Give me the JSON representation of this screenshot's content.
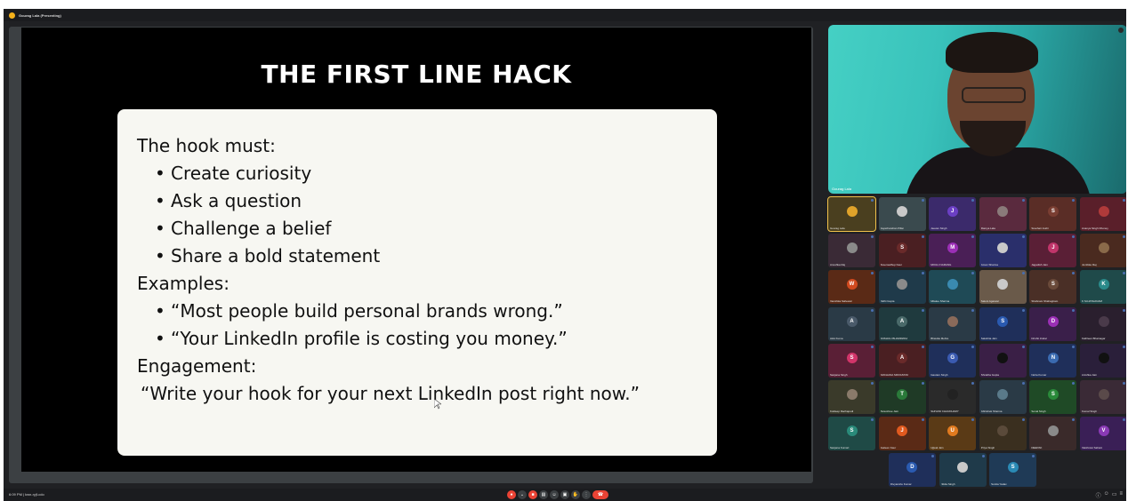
{
  "window": {
    "title": "Gourag Lala (Presenting)"
  },
  "slide": {
    "title": "THE FIRST LINE HACK",
    "intro": "The hook must:",
    "hook_points": [
      "Create curiosity",
      "Ask a question",
      "Challenge a belief",
      "Share a bold statement"
    ],
    "examples_label": "Examples:",
    "examples": [
      "“Most people build personal brands wrong.”",
      "“Your LinkedIn profile is costing you money.”"
    ],
    "engagement_label": "Engagement:",
    "engagement_quote": "“Write your hook for your next LinkedIn post right now.”"
  },
  "speaker": {
    "name": "Gourag Lala"
  },
  "colors": {
    "meet_bg": "#202124",
    "slide_bg": "#000000",
    "card_bg": "#f7f7f2",
    "leave_red": "#ea4335",
    "active_border": "#f0c14b"
  },
  "participants": [
    {
      "initial": "",
      "color": "#e0a32a",
      "name": "Gourag Lala",
      "bg": "#4a3f1f"
    },
    {
      "initial": "",
      "color": "#c9c9c9",
      "name": "Jayachandran Pillai",
      "bg": "#3a4a4e"
    },
    {
      "initial": "J",
      "color": "#6b3fc4",
      "name": "Jeevan Singh",
      "bg": "#3b2a6b"
    },
    {
      "initial": "",
      "color": "#8a7a7a",
      "name": "Ramya Lala",
      "bg": "#5a2a3e"
    },
    {
      "initial": "S",
      "color": "#7a3e32",
      "name": "Sreehari Joshi",
      "bg": "#5a2d26"
    },
    {
      "initial": "",
      "color": "#b03a3a",
      "name": "Ananya Singh Dhoney",
      "bg": "#5a1f2a"
    },
    {
      "initial": "",
      "color": "#8a8a8a",
      "name": "Anushka Raj",
      "bg": "#3a2a36"
    },
    {
      "initial": "S",
      "color": "#6a2a2a",
      "name": "Sreemadhup Kaur",
      "bg": "#4a1f22"
    },
    {
      "initial": "M",
      "color": "#9b2fb5",
      "name": "MOULI NARANG",
      "bg": "#4a1f56"
    },
    {
      "initial": "",
      "color": "#c9c9c9",
      "name": "Aman Sharma",
      "bg": "#2a2f6b"
    },
    {
      "initial": "J",
      "color": "#c0356a",
      "name": "Jagadish Jain",
      "bg": "#5a1f36"
    },
    {
      "initial": "",
      "color": "#8a6a4a",
      "name": "Jumbike Raj",
      "bg": "#4a2a1f"
    },
    {
      "initial": "W",
      "color": "#d14a1f",
      "name": "Vanshika Sahewal",
      "bg": "#5a2a16"
    },
    {
      "initial": "",
      "color": "#8a8a8a",
      "name": "Nidhi Gupta",
      "bg": "#1f3a4a"
    },
    {
      "initial": "",
      "color": "#3a8ab0",
      "name": "Mitalee Sharma",
      "bg": "#1f4a56"
    },
    {
      "initial": "",
      "color": "#c9c9c9",
      "name": "Saloni Agarwal",
      "bg": "#6a5a4a"
    },
    {
      "initial": "S",
      "color": "#6a4a3a",
      "name": "Shabnam Shahagiram",
      "bg": "#4a2f26"
    },
    {
      "initial": "K",
      "color": "#2a8a8a",
      "name": "K SUJATHANAM",
      "bg": "#1f4a4a"
    },
    {
      "initial": "A",
      "color": "#4a5a6a",
      "name": "Alok Kuma",
      "bg": "#2a3a46"
    },
    {
      "initial": "A",
      "color": "#4a6a6a",
      "name": "ANSHULI BHARDWAJ",
      "bg": "#1f3a3e"
    },
    {
      "initial": "",
      "color": "#8a6a5a",
      "name": "Bhavika Mehra",
      "bg": "#2a3a46"
    },
    {
      "initial": "S",
      "color": "#2a5ab0",
      "name": "Sakshita Jain",
      "bg": "#1f2f5a"
    },
    {
      "initial": "D",
      "color": "#9b2fb5",
      "name": "Drishti Jindal",
      "bg": "#3a1f4a"
    },
    {
      "initial": "",
      "color": "#4a3a4a",
      "name": "Kathleen Bhatnagar",
      "bg": "#2a1f2e"
    },
    {
      "initial": "S",
      "color": "#d1356a",
      "name": "Sanjana Singh",
      "bg": "#5a1f36"
    },
    {
      "initial": "A",
      "color": "#6a2a2a",
      "name": "ARCHANA SRIVASTAV",
      "bg": "#4a1f22"
    },
    {
      "initial": "G",
      "color": "#3a5ab0",
      "name": "Gautam Singh",
      "bg": "#1f2f5a"
    },
    {
      "initial": "",
      "color": "#111111",
      "name": "Shrakha Gupta",
      "bg": "#3a1f46"
    },
    {
      "initial": "N",
      "color": "#3a6ab0",
      "name": "Neha Kumar",
      "bg": "#1f2f5a"
    },
    {
      "initial": "",
      "color": "#111111",
      "name": "Anishka Jain",
      "bg": "#2a1f3a"
    },
    {
      "initial": "",
      "color": "#8a7a6a",
      "name": "Kuldeep Rachapudi",
      "bg": "#3a3a2a"
    },
    {
      "initial": "T",
      "color": "#2a7a3a",
      "name": "Tanushree Jain",
      "bg": "#1f3a26"
    },
    {
      "initial": "",
      "color": "#222222",
      "name": "SHIVANI CHAUDHARY",
      "bg": "#2a2a2a"
    },
    {
      "initial": "",
      "color": "#5a7a8a",
      "name": "Abhishek Sharma",
      "bg": "#2a3a46"
    },
    {
      "initial": "S",
      "color": "#2a8a3a",
      "name": "Sonal Singh",
      "bg": "#1f4a26"
    },
    {
      "initial": "",
      "color": "#5a4a4a",
      "name": "Komal Singh",
      "bg": "#3a2a36"
    },
    {
      "initial": "S",
      "color": "#2a8a7a",
      "name": "Sanjana Kumari",
      "bg": "#1f4a46"
    },
    {
      "initial": "J",
      "color": "#e05a1f",
      "name": "Jasleen Kaur",
      "bg": "#5a2a16"
    },
    {
      "initial": "U",
      "color": "#e07a1f",
      "name": "Ujjwal Jain",
      "bg": "#5a3a16"
    },
    {
      "initial": "",
      "color": "#5a4a3a",
      "name": "Priya Singh",
      "bg": "#3a2f1f"
    },
    {
      "initial": "",
      "color": "#8a8a8a",
      "name": "DEEPAK",
      "bg": "#3a2a2a"
    },
    {
      "initial": "V",
      "color": "#8a3ab5",
      "name": "Vaishnavi Sahani",
      "bg": "#3a1f56"
    },
    {
      "initial": "D",
      "color": "#2a5ab0",
      "name": "Divyanshu Kumar",
      "bg": "#1f2f5a"
    },
    {
      "initial": "",
      "color": "#c9c9c9",
      "name": "Nikita Singh",
      "bg": "#1f3a4a"
    },
    {
      "initial": "S",
      "color": "#2a8ab5",
      "name": "Sunita Yadav",
      "bg": "#1f3a56"
    }
  ],
  "bottombar": {
    "time": "6:09 PM | kwn-ryjf-cdo"
  }
}
